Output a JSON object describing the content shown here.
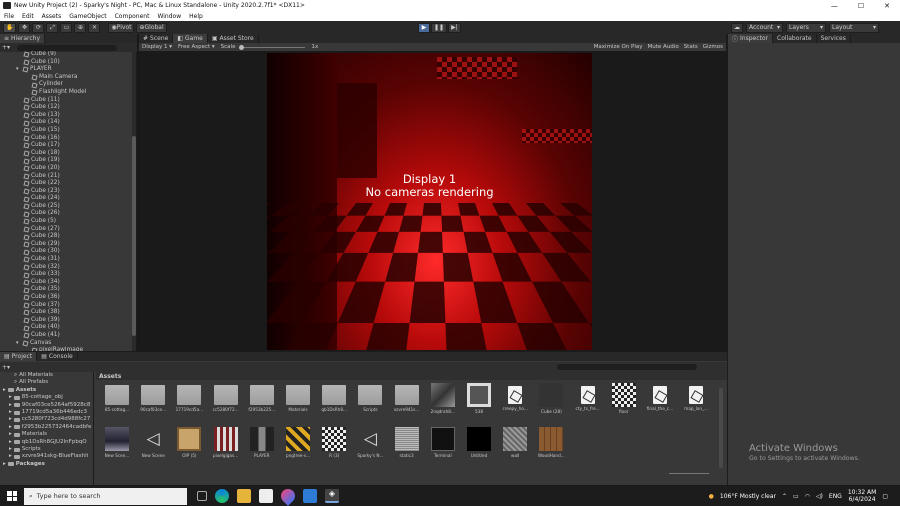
{
  "window": {
    "title": "New Unity Project (2) - Sparky's Night - PC, Mac & Linux Standalone - Unity 2020.2.7f1* <DX11>",
    "min": "—",
    "max": "☐",
    "close": "✕"
  },
  "menu": [
    "File",
    "Edit",
    "Assets",
    "GameObject",
    "Component",
    "Window",
    "Help"
  ],
  "toolbar": {
    "pivot": "Pivot",
    "global": "Global",
    "account": "Account",
    "layers": "Layers",
    "layout": "Layout"
  },
  "hierarchy": {
    "tab": "Hierarchy",
    "items": [
      {
        "label": "Cube (9)",
        "indent": 3
      },
      {
        "label": "Cube (10)",
        "indent": 3
      },
      {
        "label": "PLAYER",
        "indent": 2,
        "fold": "▾"
      },
      {
        "label": "Main Camera",
        "indent": 4
      },
      {
        "label": "Cylinder",
        "indent": 4
      },
      {
        "label": "Flashlight Model",
        "indent": 4
      },
      {
        "label": "Cube (11)",
        "indent": 3
      },
      {
        "label": "Cube (12)",
        "indent": 3
      },
      {
        "label": "Cube (13)",
        "indent": 3
      },
      {
        "label": "Cube (14)",
        "indent": 3
      },
      {
        "label": "Cube (15)",
        "indent": 3
      },
      {
        "label": "Cube (16)",
        "indent": 3
      },
      {
        "label": "Cube (17)",
        "indent": 3
      },
      {
        "label": "Cube (18)",
        "indent": 3
      },
      {
        "label": "Cube (19)",
        "indent": 3
      },
      {
        "label": "Cube (20)",
        "indent": 3
      },
      {
        "label": "Cube (21)",
        "indent": 3
      },
      {
        "label": "Cube (22)",
        "indent": 3
      },
      {
        "label": "Cube (23)",
        "indent": 3
      },
      {
        "label": "Cube (24)",
        "indent": 3
      },
      {
        "label": "Cube (25)",
        "indent": 3
      },
      {
        "label": "Cube (26)",
        "indent": 3
      },
      {
        "label": "Cube (5)",
        "indent": 3
      },
      {
        "label": "Cube (27)",
        "indent": 3
      },
      {
        "label": "Cube (28)",
        "indent": 3
      },
      {
        "label": "Cube (29)",
        "indent": 3
      },
      {
        "label": "Cube (30)",
        "indent": 3
      },
      {
        "label": "Cube (31)",
        "indent": 3
      },
      {
        "label": "Cube (32)",
        "indent": 3
      },
      {
        "label": "Cube (33)",
        "indent": 3
      },
      {
        "label": "Cube (34)",
        "indent": 3
      },
      {
        "label": "Cube (35)",
        "indent": 3
      },
      {
        "label": "Cube (36)",
        "indent": 3
      },
      {
        "label": "Cube (37)",
        "indent": 3
      },
      {
        "label": "Cube (38)",
        "indent": 3
      },
      {
        "label": "Cube (39)",
        "indent": 3
      },
      {
        "label": "Cube (40)",
        "indent": 3
      },
      {
        "label": "Cube (41)",
        "indent": 3
      },
      {
        "label": "Canvas",
        "indent": 2,
        "fold": "▾"
      },
      {
        "label": "pixelRawImage",
        "indent": 4
      }
    ]
  },
  "center": {
    "tabs": [
      "Scene",
      "Game",
      "Asset Store"
    ],
    "display": "Display 1",
    "aspect": "Free Aspect",
    "scale_label": "Scale",
    "scale_value": "1x",
    "right_items": [
      "Maximize On Play",
      "Mute Audio",
      "Stats",
      "Gizmos"
    ],
    "overlay_line1": "Display 1",
    "overlay_line2": "No cameras rendering"
  },
  "inspector": {
    "tabs": [
      "Inspector",
      "Collaborate",
      "Services"
    ]
  },
  "watermark": {
    "line1": "Activate Windows",
    "line2": "Go to Settings to activate Windows."
  },
  "project": {
    "tabs": [
      "Project",
      "Console"
    ],
    "breadcrumb": "Assets",
    "tree": [
      {
        "label": "All Materials",
        "type": "search"
      },
      {
        "label": "All Prefabs",
        "type": "search"
      },
      {
        "label": "Assets",
        "type": "root"
      },
      {
        "label": "85-cottage_obj",
        "type": "folder"
      },
      {
        "label": "90caf03ce5264af5928c8",
        "type": "folder"
      },
      {
        "label": "17719cd5a36b446edc3",
        "type": "folder"
      },
      {
        "label": "cc5280f723cd4d988fc27",
        "type": "folder"
      },
      {
        "label": "f2953b225732464cadbfe",
        "type": "folder"
      },
      {
        "label": "Materials",
        "type": "folder"
      },
      {
        "label": "qb1DsRh8GJU2InFpbqO",
        "type": "folder"
      },
      {
        "label": "Scripts",
        "type": "folder"
      },
      {
        "label": "xzvre941skg-BlueFlashli",
        "type": "folder"
      },
      {
        "label": "Packages",
        "type": "root"
      }
    ],
    "assets_row1": [
      {
        "label": "85-cottag...",
        "kind": "folder"
      },
      {
        "label": "90caf03ce...",
        "kind": "folder"
      },
      {
        "label": "17719cd5a...",
        "kind": "folder"
      },
      {
        "label": "cc5280f72...",
        "kind": "folder"
      },
      {
        "label": "f2953b225...",
        "kind": "folder"
      },
      {
        "label": "Materials",
        "kind": "folder"
      },
      {
        "label": "qb1DsRh8...",
        "kind": "folder"
      },
      {
        "label": "Scripts",
        "kind": "folder"
      },
      {
        "label": "xzvre941s...",
        "kind": "folder"
      },
      {
        "label": "2nqdrah8...",
        "kind": "photo"
      },
      {
        "label": "538",
        "kind": "tv"
      },
      {
        "label": "creepy_ho...",
        "kind": "doc"
      },
      {
        "label": "Cube (28)",
        "kind": "cube"
      },
      {
        "label": "cty_ts_fre...",
        "kind": "doc"
      },
      {
        "label": "floor",
        "kind": "check"
      },
      {
        "label": "final_the_c...",
        "kind": "doc"
      },
      {
        "label": "map_lon_...",
        "kind": "doc"
      }
    ],
    "assets_row2": [
      {
        "label": "New Scen...",
        "kind": "scene"
      },
      {
        "label": "New Scene",
        "kind": "unity"
      },
      {
        "label": "OIP (5)",
        "kind": "paper"
      },
      {
        "label": "pixelgigas...",
        "kind": "stripes"
      },
      {
        "label": "PLAYER",
        "kind": "player"
      },
      {
        "label": "pngtree-s...",
        "kind": "gold"
      },
      {
        "label": "R (3)",
        "kind": "check"
      },
      {
        "label": "Sparky's N...",
        "kind": "unity"
      },
      {
        "label": "static3",
        "kind": "static"
      },
      {
        "label": "Terminal",
        "kind": "terminal"
      },
      {
        "label": "Untitled",
        "kind": "black"
      },
      {
        "label": "wall",
        "kind": "wall"
      },
      {
        "label": "WoodHand...",
        "kind": "wood"
      }
    ]
  },
  "taskbar": {
    "search_placeholder": "Type here to search",
    "weather": "106°F  Mostly clear",
    "lang": "ENG",
    "time": "10:32 AM",
    "date": "6/4/2024"
  },
  "colors": {
    "viewport_red": "#d81414",
    "play_active": "#4a6a9a",
    "editor_bg": "#383838"
  }
}
